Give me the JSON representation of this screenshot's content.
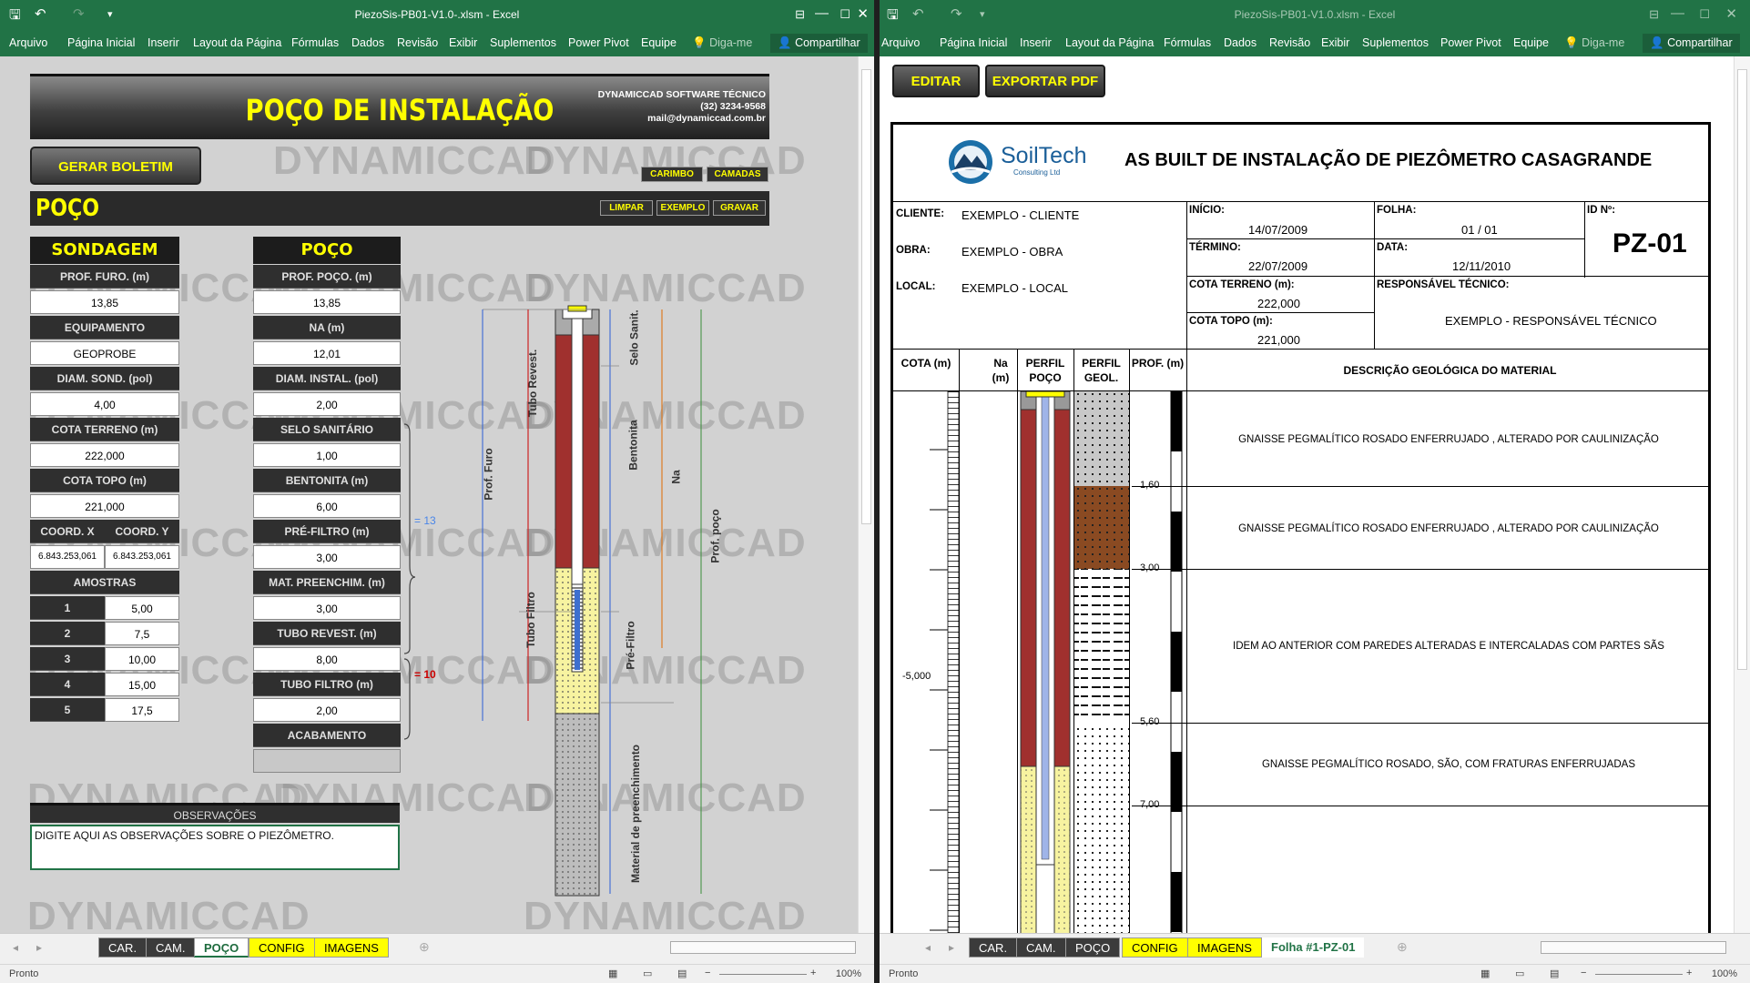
{
  "left_window": {
    "title": "PiezoSis-PB01-V1.0-.xlsm - Excel",
    "ribbon_tabs": [
      "Arquivo",
      "Página Inicial",
      "Inserir",
      "Layout da Página",
      "Fórmulas",
      "Dados",
      "Revisão",
      "Exibir",
      "Suplementos",
      "Power Pivot",
      "Equipe"
    ],
    "tell_me": "Diga-me",
    "share": "Compartilhar",
    "banner_title": "POÇO DE INSTALAÇÃO",
    "company": "DYNAMICCAD SOFTWARE TÉCNICO",
    "phone": "(32) 3234-9568",
    "email": "mail@dynamiccad.com.br",
    "watermark": "DYNAMICCAD",
    "btn_gerar": "GERAR BOLETIM",
    "btn_carimbo": "CARIMBO",
    "btn_camadas": "CAMADAS",
    "section_title": "POÇO",
    "btn_limpar": "LIMPAR",
    "btn_exemplo": "EXEMPLO",
    "btn_gravar": "GRAVAR",
    "sondagem": {
      "header": "SONDAGEM",
      "prof_furo_label": "PROF. FURO. (m)",
      "prof_furo": "13,85",
      "equip_label": "EQUIPAMENTO",
      "equip": "GEOPROBE",
      "diam_sond_label": "DIAM. SOND. (pol)",
      "diam_sond": "4,00",
      "cota_terreno_label": "COTA TERRENO (m)",
      "cota_terreno": "222,000",
      "cota_topo_label": "COTA TOPO (m)",
      "cota_topo": "221,000",
      "coord_x_label": "COORD. X",
      "coord_x": "6.843.253,061",
      "coord_y_label": "COORD. Y",
      "coord_y": "6.843.253,061",
      "amostras_label": "AMOSTRAS",
      "amostras": [
        {
          "n": "1",
          "v": "5,00"
        },
        {
          "n": "2",
          "v": "7,5"
        },
        {
          "n": "3",
          "v": "10,00"
        },
        {
          "n": "4",
          "v": "15,00"
        },
        {
          "n": "5",
          "v": "17,5"
        }
      ]
    },
    "poco": {
      "header": "POÇO",
      "prof_poco_label": "PROF. POÇO. (m)",
      "prof_poco": "13,85",
      "na_label": "NA (m)",
      "na": "12,01",
      "diam_instal_label": "DIAM. INSTAL. (pol)",
      "diam_instal": "2,00",
      "selo_label": "SELO SANITÁRIO",
      "selo": "1,00",
      "bentonita_label": "BENTONITA (m)",
      "bentonita": "6,00",
      "prefiltro_label": "PRÉ-FILTRO (m)",
      "prefiltro": "3,00",
      "matpreench_label": "MAT. PREENCHIM. (m)",
      "matpreench": "3,00",
      "tubo_revest_label": "TUBO REVEST. (m)",
      "tubo_revest": "8,00",
      "tubo_filtro_label": "TUBO FILTRO (m)",
      "tubo_filtro": "2,00",
      "acabamento_label": "ACABAMENTO"
    },
    "sum_13": "= 13",
    "sum_10": "= 10",
    "diagram_labels": {
      "prof_furo": "Prof. Furo",
      "tubo_revest": "Tubo Revest.",
      "tubo_filtro": "Tubo Filtro",
      "selo_sanit": "Selo Sanit.",
      "bentonita": "Bentonita",
      "pre_filtro": "Pré-Filtro",
      "material": "Material de preenchimento",
      "na": "Na",
      "prof_poco": "Prof. poço"
    },
    "obs_header": "OBSERVAÇÕES",
    "obs_text": "DIGITE AQUI AS OBSERVAÇÕES SOBRE O PIEZÔMETRO.",
    "tabs": [
      "CAR.",
      "CAM.",
      "POÇO",
      "CONFIG",
      "IMAGENS"
    ],
    "status": "Pronto",
    "zoom": "100%"
  },
  "right_window": {
    "title": "PiezoSis-PB01-V1.0.xlsm - Excel",
    "ribbon_tabs": [
      "Arquivo",
      "Página Inicial",
      "Inserir",
      "Layout da Página",
      "Fórmulas",
      "Dados",
      "Revisão",
      "Exibir",
      "Suplementos",
      "Power Pivot",
      "Equipe"
    ],
    "tell_me": "Diga-me",
    "share": "Compartilhar",
    "btn_editar": "EDITAR",
    "btn_exportar": "EXPORTAR PDF",
    "logo_name": "SoilTech",
    "logo_sub": "Consulting Ltd",
    "report_title": "AS BUILT DE INSTALAÇÃO DE PIEZÔMETRO CASAGRANDE",
    "cliente_label": "CLIENTE:",
    "cliente": "EXEMPLO - CLIENTE",
    "obra_label": "OBRA:",
    "obra": "EXEMPLO - OBRA",
    "local_label": "LOCAL:",
    "local": "EXEMPLO - LOCAL",
    "inicio_label": "INÍCIO:",
    "inicio": "14/07/2009",
    "termino_label": "TÉRMINO:",
    "termino": "22/07/2009",
    "cota_terreno_label": "COTA TERRENO (m):",
    "cota_terreno": "222,000",
    "cota_topo_label": "COTA TOPO (m):",
    "cota_topo": "221,000",
    "folha_label": "FOLHA:",
    "folha": "01 / 01",
    "data_label": "DATA:",
    "data": "12/11/2010",
    "idn_label": "ID Nº:",
    "idn": "PZ-01",
    "resp_label": "RESPONSÁVEL TÉCNICO:",
    "resp": "EXEMPLO - RESPONSÁVEL TÉCNICO",
    "col_cota": "COTA (m)",
    "col_na": "Na (m)",
    "col_perfil_poco": "PERFIL POÇO",
    "col_perfil_geol": "PERFIL GEOL.",
    "col_prof": "PROF. (m)",
    "col_desc": "DESCRIÇÃO GEOLÓGICA DO MATERIAL",
    "cota_mark": "-5,000",
    "depths": [
      "1,60",
      "3,00",
      "5,60",
      "7,00"
    ],
    "descriptions": [
      "GNAISSE PEGMALÍTICO ROSADO ENFERRUJADO , ALTERADO POR CAULINIZAÇÃO",
      "GNAISSE PEGMALÍTICO ROSADO ENFERRUJADO , ALTERADO POR CAULINIZAÇÃO",
      "IDEM AO ANTERIOR COM PAREDES ALTERADAS E INTERCALADAS COM PARTES SÃS",
      "GNAISSE PEGMALÍTICO ROSADO, SÃO,  COM FRATURAS ENFERRUJADAS"
    ],
    "tabs": [
      "CAR.",
      "CAM.",
      "POÇO",
      "CONFIG",
      "IMAGENS",
      "Folha #1-PZ-01"
    ],
    "status": "Pronto",
    "zoom": "100%"
  }
}
